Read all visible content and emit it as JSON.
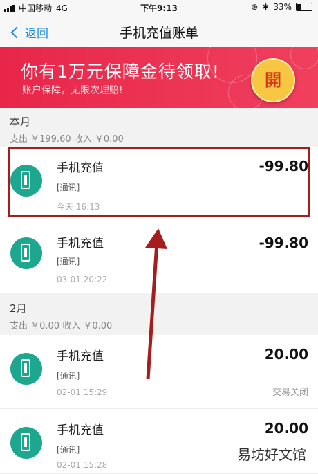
{
  "status_bar": {
    "carrier": "中国移动",
    "network": "4G",
    "time": "下午9:13",
    "battery": "33%",
    "battery_level": 0.33
  },
  "nav": {
    "back_label": "返回",
    "title": "手机充值账单"
  },
  "banner": {
    "title": "你有1万元保障金待领取!",
    "subtitle": "账户保障，无限次理赔!",
    "coin_label": "開"
  },
  "sections": [
    {
      "month": "本月",
      "summary": "支出 ￥199.60    收入 ￥0.00",
      "items": [
        {
          "title": "手机充值",
          "category": "[通讯]",
          "time": "今天  16:13",
          "amount": "-99.80",
          "status": ""
        },
        {
          "title": "手机充值",
          "category": "[通讯]",
          "time": "03-01  20:22",
          "amount": "-99.80",
          "status": ""
        }
      ]
    },
    {
      "month": "2月",
      "summary": "支出 ￥0.00    收入 ￥0.00",
      "items": [
        {
          "title": "手机充值",
          "category": "[通讯]",
          "time": "02-01  15:29",
          "amount": "20.00",
          "status": "交易关闭"
        },
        {
          "title": "手机充值",
          "category": "[通讯]",
          "time": "02-01  15:28",
          "amount": "20.00",
          "status": ""
        }
      ]
    }
  ],
  "watermark": "易坊好文馆",
  "colors": {
    "accent": "#1e8ae0",
    "banner_red": "#e8264a",
    "icon_teal": "#1ea78f",
    "annotation_red": "#a51d1d"
  }
}
